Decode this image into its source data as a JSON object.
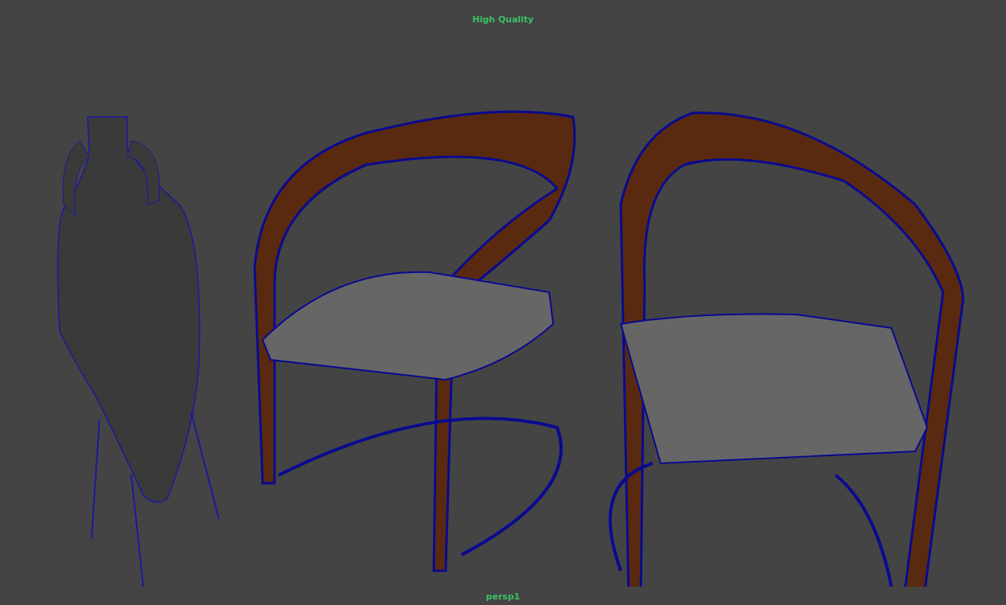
{
  "viewport": {
    "render_mode": "High Quality",
    "camera": "persp1"
  }
}
